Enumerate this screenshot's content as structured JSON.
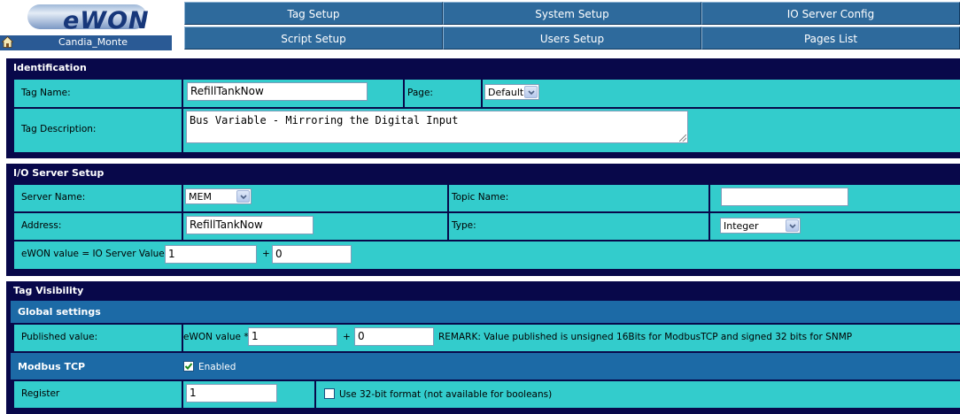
{
  "header": {
    "logo_text": "eWON",
    "site_name": "Candia_Monte",
    "nav": [
      {
        "label": "Tag Setup"
      },
      {
        "label": "System Setup"
      },
      {
        "label": "IO Server Config"
      },
      {
        "label": "Script Setup"
      },
      {
        "label": "Users Setup"
      },
      {
        "label": "Pages List"
      }
    ]
  },
  "identification": {
    "title": "Identification",
    "tag_name_label": "Tag Name:",
    "tag_name_value": "RefillTankNow",
    "page_label": "Page:",
    "page_value": "Default",
    "tag_description_label": "Tag Description:",
    "tag_description_value": "Bus Variable - Mirroring the Digital Input"
  },
  "io_server": {
    "title": "I/O Server Setup",
    "server_name_label": "Server Name:",
    "server_name_value": "MEM",
    "topic_name_label": "Topic Name:",
    "topic_name_value": "",
    "address_label": "Address:",
    "address_value": "RefillTankNow",
    "type_label": "Type:",
    "type_value": "Integer",
    "scale_label": "eWON value = IO Server Value *",
    "scale_value": "1",
    "plus_label": "+",
    "offset_value": "0"
  },
  "visibility": {
    "title": "Tag Visibility",
    "global_settings_label": "Global settings",
    "published_value_label": "Published value:",
    "ewon_value_label": "eWON value *",
    "published_scale_value": "1",
    "plus_label": "+",
    "published_offset_value": "0",
    "remark": "REMARK: Value published is unsigned 16Bits for ModbusTCP and signed 32 bits for SNMP",
    "modbus_label": "Modbus TCP",
    "modbus_enabled_label": "Enabled",
    "modbus_enabled": true,
    "register_label": "Register",
    "register_value": "1",
    "use32_label": "Use 32-bit format (not available for booleans)",
    "use32_checked": false
  },
  "colors": {
    "panel_bg": "#08084a",
    "cell_bg": "#33cccc",
    "nav_bg": "#2e6a9c",
    "subheader_bg": "#1c6aa6"
  }
}
